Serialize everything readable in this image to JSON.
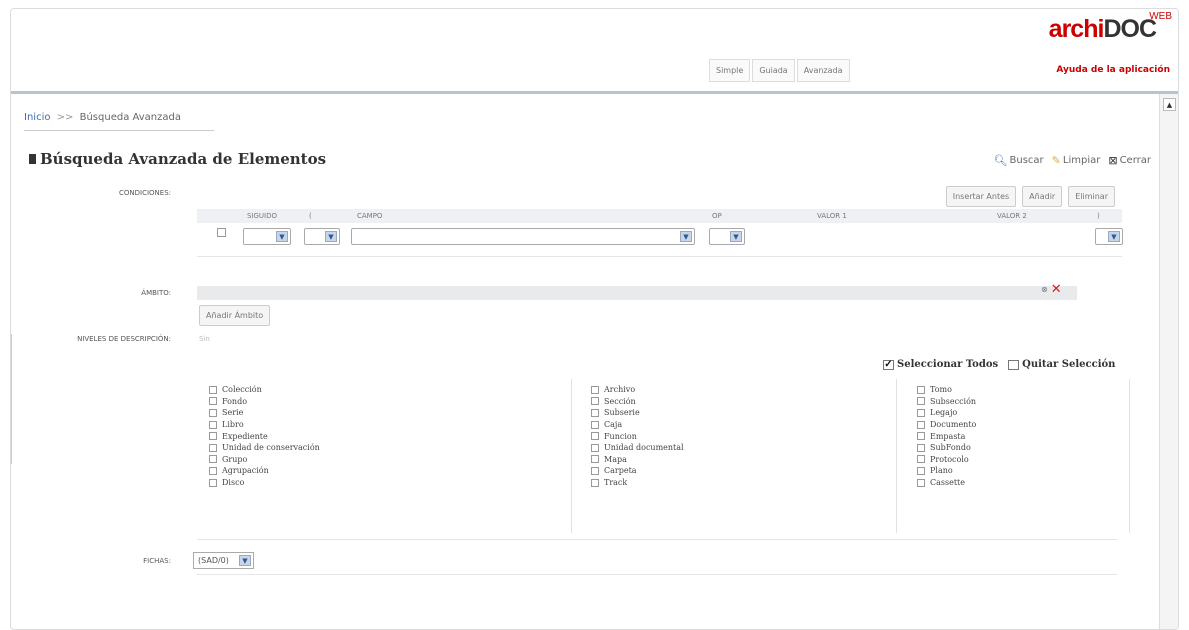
{
  "header": {
    "logo_archi": "archi",
    "logo_doc": "DOC",
    "logo_web": "WEB",
    "help_link": "Ayuda de la aplicación",
    "modes": [
      "Simple",
      "Guiada",
      "Avanzada"
    ]
  },
  "breadcrumb": {
    "home": "Inicio",
    "sep": ">>",
    "current": "Búsqueda Avanzada"
  },
  "page": {
    "title": "Búsqueda Avanzada de Elementos"
  },
  "actions": {
    "search": "Buscar",
    "clear": "Limpiar",
    "close": "Cerrar"
  },
  "conditions": {
    "label": "CONDICIONES:",
    "buttons": [
      "Insertar Antes",
      "Añadir",
      "Eliminar"
    ],
    "columns": {
      "sigue": "SIGUIDO",
      "paren_open": "(",
      "campo": "CAMPO",
      "op": "OP",
      "valor1": "VALOR 1",
      "valor2": "VALOR 2",
      "paren_close": ")"
    }
  },
  "ambito": {
    "label": "ÁMBITO:",
    "add_button": "Añadir Ámbito"
  },
  "niveles": {
    "label": "NIVELES DE DESCRIPCIÓN:",
    "value": "Sin",
    "select_all": "Seleccionar Todos",
    "clear_selection": "Quitar Selección",
    "col1": [
      "Colección",
      "Fondo",
      "Serie",
      "Libro",
      "Expediente",
      "Unidad de conservación",
      "Grupo",
      "Agrupación",
      "Disco"
    ],
    "col2": [
      "Archivo",
      "Sección",
      "Subserie",
      "Caja",
      "Funcion",
      "Unidad documental",
      "Mapa",
      "Carpeta",
      "Track"
    ],
    "col3": [
      "Tomo",
      "Subsección",
      "Legajo",
      "Documento",
      "Empasta",
      "SubFondo",
      "Protocolo",
      "Plano",
      "Cassette"
    ]
  },
  "fichas": {
    "label": "FICHAS:",
    "value": "(SAD/0)"
  },
  "colors": {
    "accent_red": "#cc0000",
    "link_blue": "#3b6fb6",
    "header_line": "#b7c4cf"
  }
}
